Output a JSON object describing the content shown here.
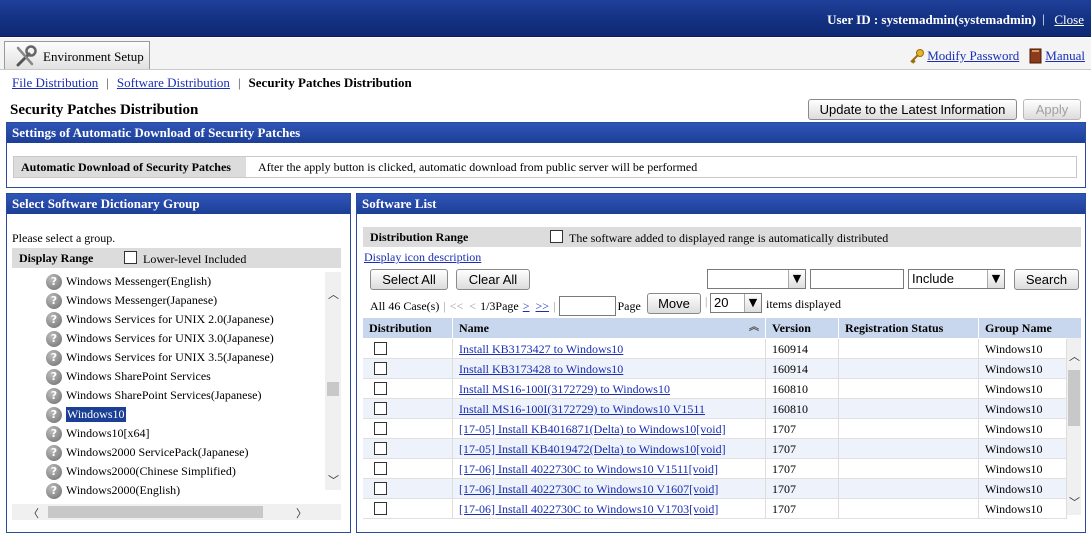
{
  "header": {
    "user_id": "User ID : systemadmin(systemadmin)",
    "close": "Close"
  },
  "tabbar": {
    "env_tab": "Environment Setup",
    "modify_password": "Modify Password",
    "manual": "Manual"
  },
  "breadcrumb": {
    "file_distribution": "File Distribution",
    "software_distribution": "Software Distribution",
    "current": "Security Patches Distribution"
  },
  "page": {
    "title": "Security Patches Distribution",
    "update_button": "Update to the Latest Information",
    "apply_button": "Apply"
  },
  "auto_download": {
    "heading": "Settings of Automatic Download of Security Patches",
    "label": "Automatic Download of Security Patches",
    "value": "After the apply button is clicked, automatic download from public server will be performed"
  },
  "group_panel": {
    "heading": "Select Software Dictionary Group",
    "prompt": "Please select a group.",
    "display_range": "Display Range",
    "lower_level": "Lower-level Included",
    "items": [
      "Windows Messenger(English)",
      "Windows Messenger(Japanese)",
      "Windows Services for UNIX 2.0(Japanese)",
      "Windows Services for UNIX 3.0(Japanese)",
      "Windows Services for UNIX 3.5(Japanese)",
      "Windows SharePoint Services",
      "Windows SharePoint Services(Japanese)",
      "Windows10",
      "Windows10[x64]",
      "Windows2000 ServicePack(Japanese)",
      "Windows2000(Chinese Simplified)",
      "Windows2000(English)"
    ],
    "selected_index": 7
  },
  "software_panel": {
    "heading": "Software List",
    "distribution_range": "Distribution Range",
    "auto_distribute": "The software added to displayed range is automatically distributed",
    "icon_desc": "Display icon description",
    "select_all": "Select All",
    "clear_all": "Clear All",
    "filter_mode": "Include",
    "search": "Search",
    "pager": {
      "total": "All 46 Case(s)",
      "first": "<<",
      "prev": "<",
      "page": "1/3Page",
      "next": ">",
      "last": ">>",
      "page_label": "Page",
      "move": "Move",
      "per_page": "20",
      "items_displayed": "items displayed"
    },
    "columns": [
      "Distribution",
      "Name",
      "Version",
      "Registration Status",
      "Group Name"
    ],
    "rows": [
      {
        "name": "Install KB3173427 to Windows10",
        "version": "160914",
        "status": "",
        "group": "Windows10"
      },
      {
        "name": "Install KB3173428 to Windows10",
        "version": "160914",
        "status": "",
        "group": "Windows10"
      },
      {
        "name": "Install MS16-100I(3172729) to Windows10",
        "version": "160810",
        "status": "",
        "group": "Windows10"
      },
      {
        "name": "Install MS16-100I(3172729) to Windows10 V1511",
        "version": "160810",
        "status": "",
        "group": "Windows10"
      },
      {
        "name": "[17-05] Install KB4016871(Delta) to Windows10[void]",
        "version": "1707",
        "status": "",
        "group": "Windows10"
      },
      {
        "name": "[17-05] Install KB4019472(Delta) to Windows10[void]",
        "version": "1707",
        "status": "",
        "group": "Windows10"
      },
      {
        "name": "[17-06] Install 4022730C to Windows10 V1511[void]",
        "version": "1707",
        "status": "",
        "group": "Windows10"
      },
      {
        "name": "[17-06] Install 4022730C to Windows10 V1607[void]",
        "version": "1707",
        "status": "",
        "group": "Windows10"
      },
      {
        "name": "[17-06] Install 4022730C to Windows10 V1703[void]",
        "version": "1707",
        "status": "",
        "group": "Windows10"
      }
    ]
  }
}
